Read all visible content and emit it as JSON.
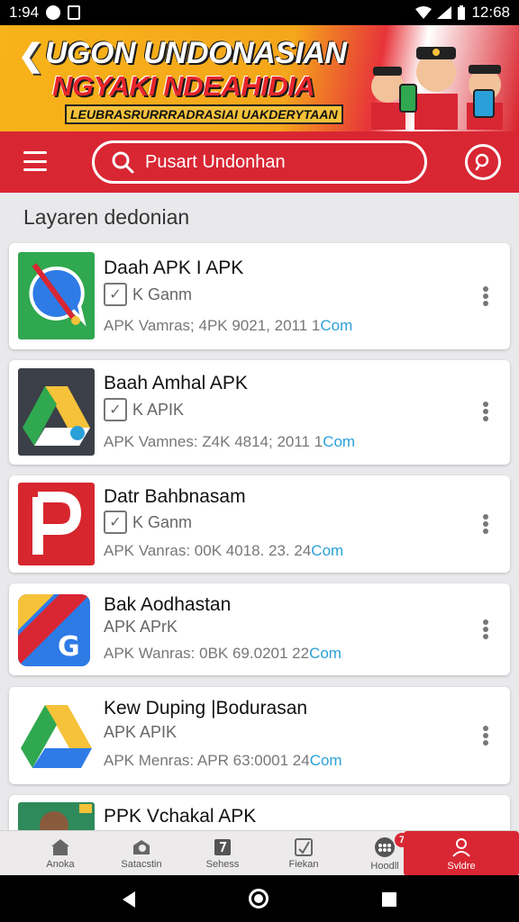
{
  "status_bar": {
    "time": "1:94",
    "clock": "12:68"
  },
  "banner": {
    "title_line1": "UGON UNDONASIAN",
    "title_line2": "NGYAKI NDEAHIDIA",
    "tagline": "LEUBRASRURRRADRASIAI UAKDERYTAAN"
  },
  "search": {
    "placeholder": "Pusart Undonhan"
  },
  "section_title": "Layaren dedonian",
  "apps": [
    {
      "name": "Daah APK I APK",
      "sub": "K  Ganm",
      "meta": "APK  Vamras; 4PK  9021, 2011 1",
      "link": "Com",
      "icon": "chat-icon",
      "color": "#2fa84f"
    },
    {
      "name": "Baah Amhal APK",
      "sub": "K  APIK",
      "meta": "APK  Vamnes: Z4K  4814; 2011 1",
      "link": "Com",
      "icon": "drive-icon",
      "color": "#3b3f47"
    },
    {
      "name": "Datr Bahbnasam",
      "sub": "K  Ganm",
      "meta": "APK  Vanras: 00K  4018. 23. 24",
      "link": "Com",
      "icon": "p-icon",
      "color": "#d7262e"
    },
    {
      "name": "Bak Aodhastan",
      "sub": "APK  APrK",
      "meta": "APK  Wanras: 0BK  69.0201 22",
      "link": "Com",
      "icon": "maps-icon",
      "color": "#2e7be6"
    },
    {
      "name": "Kew Duping |Bodurasan",
      "sub": "APK  APIK",
      "meta": "APK  Menras: APR  63:0001 24",
      "link": "Com",
      "icon": "drive-icon",
      "color": "#ffffff"
    },
    {
      "name": "PPK Vchakal APK",
      "sub": "",
      "meta": "",
      "link": "",
      "icon": "portrait-icon",
      "color": "#2e8a5b"
    }
  ],
  "bottom_nav": [
    {
      "label": "Anoka",
      "icon": "home-icon"
    },
    {
      "label": "Satacstin",
      "icon": "search-icon"
    },
    {
      "label": "Sehess",
      "icon": "bookmark-icon"
    },
    {
      "label": "Fiekan",
      "icon": "edit-icon"
    },
    {
      "label": "Hoodll",
      "icon": "apps-icon",
      "badge": "7"
    },
    {
      "label": "Svldre",
      "icon": "profile-icon"
    }
  ]
}
